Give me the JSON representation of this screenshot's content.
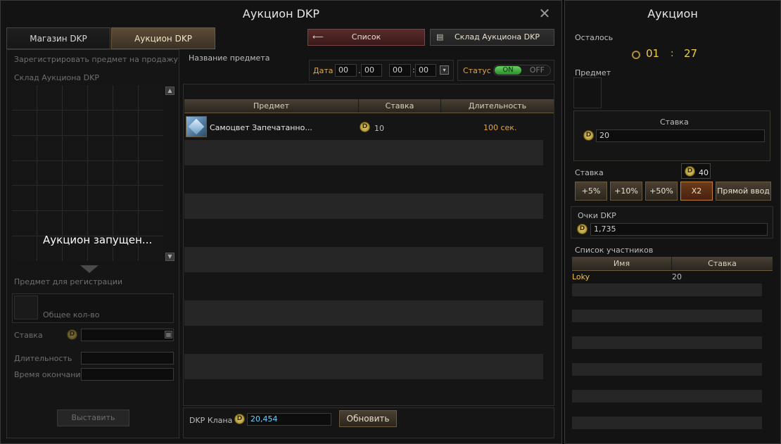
{
  "main": {
    "title": "Аукцион DKP",
    "tabs": [
      {
        "label": "Магазин DKP"
      },
      {
        "label": "Аукцион DKP"
      }
    ],
    "list_button": "Список",
    "warehouse_button": "Склад Аукциона DKP",
    "left": {
      "register_label": "Зарегистрировать предмет на продажу",
      "warehouse_label": "Склад Аукциона DKP",
      "running_text": "Аукцион запущен...",
      "item_to_register": "Предмет для регистрации",
      "total_qty": "Общее кол-во",
      "bid_label": "Ставка",
      "duration_label": "Длительность",
      "end_time_label": "Время окончания",
      "place_button": "Выставить"
    },
    "filter": {
      "item_name_label": "Название предмета",
      "date_label": "Дата",
      "date_d1": "00",
      "date_d2": "00",
      "time_h": "00",
      "time_m": "00",
      "status_label": "Статус",
      "on": "ON",
      "off": "OFF"
    },
    "table": {
      "headers": [
        "Предмет",
        "Ставка",
        "Длительность"
      ],
      "rows": [
        {
          "item": "Самоцвет Запечатанно...",
          "bid": "10",
          "duration": "100 сек."
        }
      ]
    },
    "footer": {
      "clan_dkp_label": "DKP Клана",
      "clan_dkp_value": "20,454",
      "refresh_button": "Обновить"
    }
  },
  "side": {
    "title": "Аукцион",
    "remaining_label": "Осталось",
    "timer_min": "01",
    "timer_sep": ":",
    "timer_sec": "27",
    "item_label": "Предмет",
    "current_bid_label": "Ставка",
    "current_bid_value": "20",
    "bid_label": "Ставка",
    "bid_preview": "40",
    "buttons": [
      "+5%",
      "+10%",
      "+50%",
      "X2",
      "Прямой ввод"
    ],
    "dkp_label": "Очки DKP",
    "dkp_value": "1,735",
    "participants_label": "Список участников",
    "participants_headers": [
      "Имя",
      "Ставка"
    ],
    "participants": [
      {
        "name": "Loky",
        "bid": "20"
      }
    ]
  },
  "colors": {
    "gold": "#e0a64a",
    "on_green": "#4cba44",
    "accent_red": "#5a2a2a",
    "dkp_value": "#6fd0ff"
  }
}
